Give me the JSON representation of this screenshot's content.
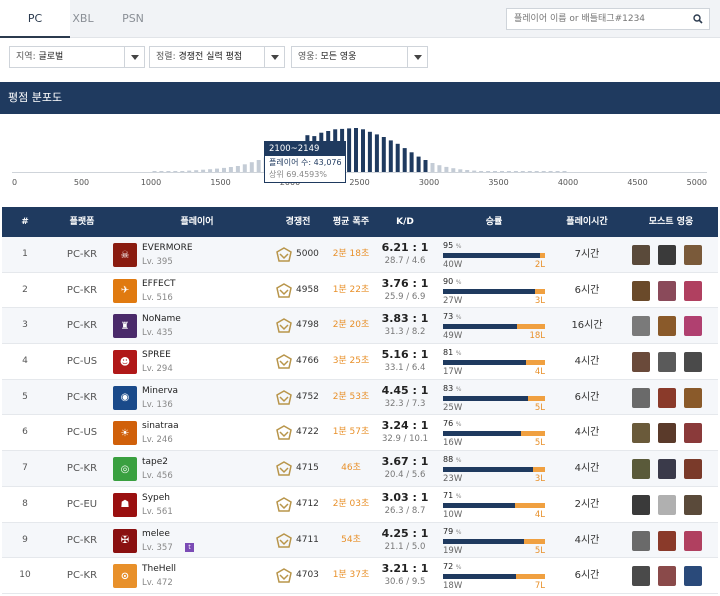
{
  "tabs": [
    {
      "label": "PC",
      "active": true
    },
    {
      "label": "XBL",
      "active": false
    },
    {
      "label": "PSN",
      "active": false
    }
  ],
  "search": {
    "placeholder": "플레이어 이름 or 배틀태그#1234"
  },
  "filters": [
    {
      "label": "지역",
      "value": "글로벌"
    },
    {
      "label": "정렬",
      "value": "경쟁전 실력 평점"
    },
    {
      "label": "영웅",
      "value": "모든 영웅"
    }
  ],
  "distribution": {
    "title": "평점 분포도",
    "tooltip": {
      "range": "2100~2149",
      "players_label": "플레이어 수",
      "players": "43,076",
      "percentile_label": "상위",
      "percentile": "69.4593%"
    }
  },
  "chart_data": {
    "type": "bar",
    "title": "평점 분포도",
    "xlim": [
      0,
      5000
    ],
    "x_ticks": [
      "0",
      "500",
      "1000",
      "1500",
      "2000",
      "2500",
      "3000",
      "3500",
      "4000",
      "4500",
      "5000"
    ],
    "bin_width": 50,
    "bins_start": [
      1000,
      1050,
      1100,
      1150,
      1200,
      1250,
      1300,
      1350,
      1400,
      1450,
      1500,
      1550,
      1600,
      1650,
      1700,
      1750,
      1800,
      1850,
      1900,
      1950,
      2000,
      2050,
      2100,
      2150,
      2200,
      2250,
      2300,
      2350,
      2400,
      2450,
      2500,
      2550,
      2600,
      2650,
      2700,
      2750,
      2800,
      2850,
      2900,
      2950,
      3000,
      3050,
      3100,
      3150,
      3200,
      3250,
      3300,
      3350,
      3400,
      3450,
      3500,
      3550,
      3600,
      3650,
      3700,
      3750,
      3800,
      3850,
      3900,
      3950
    ],
    "values": [
      400,
      550,
      700,
      900,
      1200,
      1600,
      2100,
      2700,
      3300,
      4000,
      4800,
      5800,
      7000,
      9000,
      11500,
      14000,
      17000,
      20500,
      24500,
      28000,
      31000,
      33000,
      43076,
      42000,
      46000,
      48000,
      50000,
      50500,
      51000,
      51500,
      50000,
      47000,
      44000,
      41000,
      37000,
      33000,
      28000,
      23000,
      18000,
      14000,
      10500,
      8000,
      6000,
      4500,
      3200,
      2300,
      1600,
      1100,
      800,
      600,
      450,
      330,
      240,
      170,
      120,
      90,
      60,
      40,
      30,
      20
    ],
    "highlight_bin": "2100~2149"
  },
  "table": {
    "headers": [
      "#",
      "플랫폼",
      "플레이어",
      "경쟁전",
      "평균 폭주",
      "K/D",
      "승률",
      "플레이시간",
      "모스트 영웅"
    ],
    "rows": [
      {
        "rank": "1",
        "platform": "PC-KR",
        "name": "EVERMORE",
        "level": "Lv. 395",
        "sr": "5000",
        "streak": "2분 18초",
        "kd": "6.21 : 1",
        "kd_detail": "28.7 / 4.6",
        "winrate": "95",
        "winrate_num": 95,
        "wins": "40W",
        "losses": "2L",
        "playtime": "7시간",
        "avatar_color": "#8a1c10",
        "avatar_char": "☠",
        "twitch": false,
        "heroes": [
          "#5a4a3a",
          "#3a3a3a",
          "#7a5a3a"
        ]
      },
      {
        "rank": "2",
        "platform": "PC-KR",
        "name": "EFFECT",
        "level": "Lv. 516",
        "sr": "4958",
        "streak": "1분 22초",
        "kd": "3.76 : 1",
        "kd_detail": "25.9 / 6.9",
        "winrate": "90",
        "winrate_num": 90,
        "wins": "27W",
        "losses": "3L",
        "playtime": "6시간",
        "avatar_color": "#e07a10",
        "avatar_char": "✈",
        "twitch": false,
        "heroes": [
          "#6a4a2a",
          "#8a4a5a",
          "#b04060"
        ]
      },
      {
        "rank": "3",
        "platform": "PC-KR",
        "name": "NoName",
        "level": "Lv. 435",
        "sr": "4798",
        "streak": "2분 20초",
        "kd": "3.83 : 1",
        "kd_detail": "31.3 / 8.2",
        "winrate": "73",
        "winrate_num": 73,
        "wins": "49W",
        "losses": "18L",
        "playtime": "16시간",
        "avatar_color": "#4a2a6a",
        "avatar_char": "♜",
        "twitch": false,
        "heroes": [
          "#7a7a7a",
          "#8a5a2a",
          "#b04070"
        ]
      },
      {
        "rank": "4",
        "platform": "PC-US",
        "name": "SPREE",
        "level": "Lv. 294",
        "sr": "4766",
        "streak": "3분 25초",
        "kd": "5.16 : 1",
        "kd_detail": "33.1 / 6.4",
        "winrate": "81",
        "winrate_num": 81,
        "wins": "17W",
        "losses": "4L",
        "playtime": "4시간",
        "avatar_color": "#b01818",
        "avatar_char": "☻",
        "twitch": false,
        "heroes": [
          "#6a4a3a",
          "#5a5a5a",
          "#4a4a4a"
        ]
      },
      {
        "rank": "5",
        "platform": "PC-KR",
        "name": "Minerva",
        "level": "Lv. 136",
        "sr": "4752",
        "streak": "2분 53초",
        "kd": "4.45 : 1",
        "kd_detail": "32.3 / 7.3",
        "winrate": "83",
        "winrate_num": 83,
        "wins": "25W",
        "losses": "5L",
        "playtime": "6시간",
        "avatar_color": "#1a4a8a",
        "avatar_char": "◉",
        "twitch": false,
        "heroes": [
          "#6a6a6a",
          "#8a3a2a",
          "#8a5a2a"
        ]
      },
      {
        "rank": "6",
        "platform": "PC-US",
        "name": "sinatraa",
        "level": "Lv. 246",
        "sr": "4722",
        "streak": "1분 57초",
        "kd": "3.24 : 1",
        "kd_detail": "32.9 / 10.1",
        "winrate": "76",
        "winrate_num": 76,
        "wins": "16W",
        "losses": "5L",
        "playtime": "4시간",
        "avatar_color": "#d0600a",
        "avatar_char": "☀",
        "twitch": false,
        "heroes": [
          "#6a5a3a",
          "#5a3a2a",
          "#8a3a3a"
        ]
      },
      {
        "rank": "7",
        "platform": "PC-KR",
        "name": "tape2",
        "level": "Lv. 456",
        "sr": "4715",
        "streak": "46초",
        "kd": "3.67 : 1",
        "kd_detail": "20.4 / 5.6",
        "winrate": "88",
        "winrate_num": 88,
        "wins": "23W",
        "losses": "3L",
        "playtime": "4시간",
        "avatar_color": "#3aa040",
        "avatar_char": "◎",
        "twitch": false,
        "heroes": [
          "#5a5a3a",
          "#3a3a4a",
          "#7a3a2a"
        ]
      },
      {
        "rank": "8",
        "platform": "PC-EU",
        "name": "Sypeh",
        "level": "Lv. 561",
        "sr": "4712",
        "streak": "2분 03초",
        "kd": "3.03 : 1",
        "kd_detail": "26.3 / 8.7",
        "winrate": "71",
        "winrate_num": 71,
        "wins": "10W",
        "losses": "4L",
        "playtime": "2시간",
        "avatar_color": "#9a1010",
        "avatar_char": "☗",
        "twitch": false,
        "heroes": [
          "#3a3a3a",
          "#b0b0b0",
          "#5a4a3a"
        ]
      },
      {
        "rank": "9",
        "platform": "PC-KR",
        "name": "melee",
        "level": "Lv. 357",
        "sr": "4711",
        "streak": "54초",
        "kd": "4.25 : 1",
        "kd_detail": "21.1 / 5.0",
        "winrate": "79",
        "winrate_num": 79,
        "wins": "19W",
        "losses": "5L",
        "playtime": "4시간",
        "avatar_color": "#8a1010",
        "avatar_char": "✠",
        "twitch": true,
        "heroes": [
          "#6a6a6a",
          "#8a3a2a",
          "#b04060"
        ]
      },
      {
        "rank": "10",
        "platform": "PC-KR",
        "name": "TheHell",
        "level": "Lv. 472",
        "sr": "4703",
        "streak": "1분 37초",
        "kd": "3.21 : 1",
        "kd_detail": "30.6 / 9.5",
        "winrate": "72",
        "winrate_num": 72,
        "wins": "18W",
        "losses": "7L",
        "playtime": "6시간",
        "avatar_color": "#e8902a",
        "avatar_char": "⊙",
        "twitch": false,
        "heroes": [
          "#4a4a4a",
          "#8a4a4a",
          "#2a4a7a"
        ]
      }
    ]
  },
  "colors": {
    "navy": "#1f3a5f",
    "orange": "#e8902a",
    "bar_default": "#c4ccd6",
    "bar_center": "#1f3a5f"
  }
}
